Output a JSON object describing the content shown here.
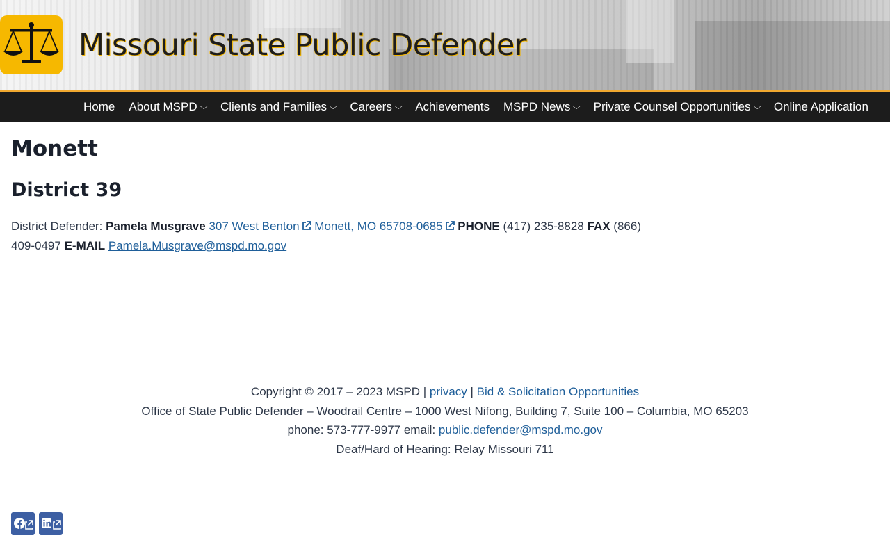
{
  "header": {
    "site_title": "Missouri State Public Defender",
    "logo_icon": "scales-of-justice-icon",
    "accent_color": "#f6b800",
    "nav_border_color": "#f0a830"
  },
  "nav": {
    "items": [
      {
        "label": "Home",
        "has_dropdown": false
      },
      {
        "label": "About MSPD",
        "has_dropdown": true
      },
      {
        "label": "Clients and Families",
        "has_dropdown": true
      },
      {
        "label": "Careers",
        "has_dropdown": true
      },
      {
        "label": "Achievements",
        "has_dropdown": false
      },
      {
        "label": "MSPD News",
        "has_dropdown": true
      },
      {
        "label": "Private Counsel Opportunities",
        "has_dropdown": true
      },
      {
        "label": "Online Application",
        "has_dropdown": false
      }
    ]
  },
  "main": {
    "title": "Monett",
    "district": "District 39",
    "defender_label": "District Defender:",
    "defender_name": "Pamela Musgrave",
    "address_line1": "307 West Benton",
    "address_line2": "Monett, MO 65708-0685",
    "phone_label": "PHONE",
    "phone": "(417) 235-8828",
    "fax_label": "FAX",
    "fax_part1": "(866)",
    "fax_part2": "409-0497",
    "email_label": "E-MAIL",
    "email": "Pamela.Musgrave@mspd.mo.gov",
    "link_color": "#1f5f9a"
  },
  "footer": {
    "copyright": "Copyright © 2017 – 2023 MSPD",
    "separator": "|",
    "privacy": "privacy",
    "bids": "Bid & Solicitation Opportunities",
    "office": "Office of State Public Defender – Woodrail Centre – 1000 West Nifong, Building 7, Suite 100 – Columbia, MO 65203",
    "phone_text": "phone: 573-777-9977 email:",
    "email": "public.defender@mspd.mo.gov",
    "relay": "Deaf/Hard of Hearing: Relay Missouri 711"
  },
  "social": [
    {
      "icon": "facebook-icon"
    },
    {
      "icon": "linkedin-icon"
    }
  ]
}
